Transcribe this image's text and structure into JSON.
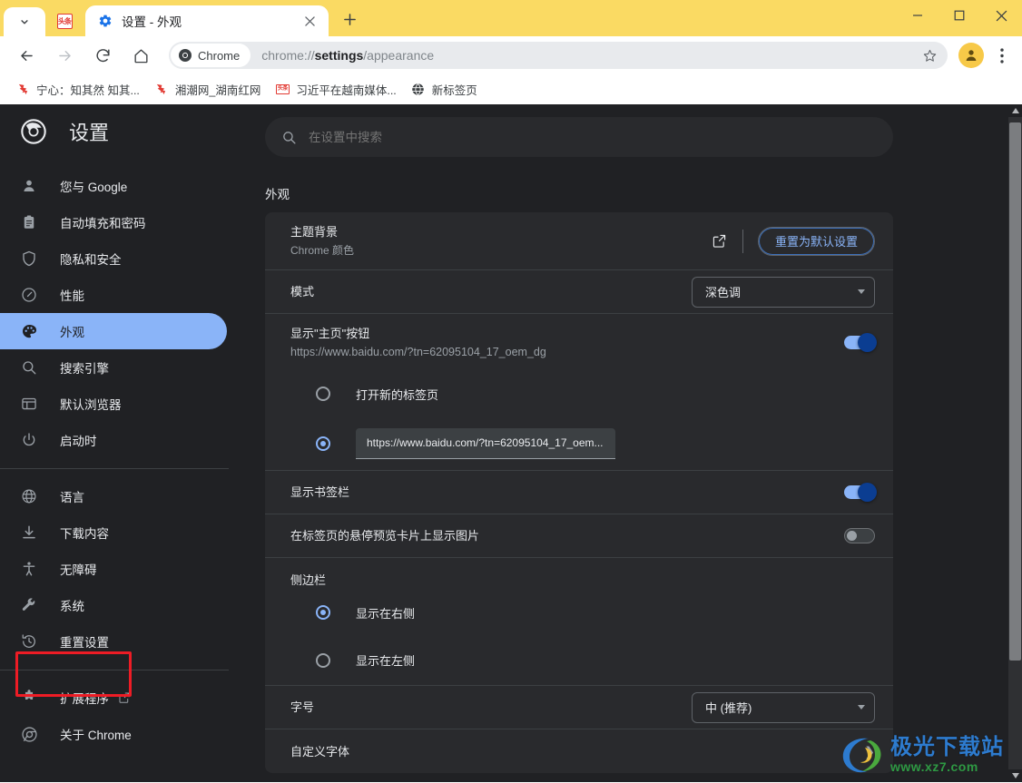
{
  "window": {
    "minimize_label": "—",
    "maximize_label": "□",
    "close_label": "✕"
  },
  "tabstrip": {
    "tab_search_name": "tab-search",
    "pinned_tab_label": "头条",
    "active_tab_title": "设置 - 外观",
    "new_tab_label": "+",
    "close_tab_label": "✕"
  },
  "toolbar": {
    "back_label": "←",
    "forward_label": "→",
    "reload_label": "⟳",
    "home_label": "⌂",
    "chrome_chip_label": "Chrome",
    "url_prefix": "chrome://",
    "url_bold": "settings",
    "url_suffix": "/appearance",
    "bookmark_star": "☆",
    "menu_label": "⋮"
  },
  "bookmarks": [
    {
      "label": "宁心：知其然 知其...",
      "icon": "xiangchao-icon"
    },
    {
      "label": "湘潮网_湖南红网",
      "icon": "xiangchao-icon"
    },
    {
      "label": "习近平在越南媒体...",
      "icon": "toutiao-icon"
    },
    {
      "label": "新标签页",
      "icon": "globe-icon"
    }
  ],
  "settings": {
    "title": "设置",
    "search": {
      "placeholder": "在设置中搜索",
      "value": ""
    },
    "sidebar": [
      {
        "label": "您与 Google",
        "icon": "person-icon",
        "selected": false
      },
      {
        "label": "自动填充和密码",
        "icon": "clipboard-icon",
        "selected": false
      },
      {
        "label": "隐私和安全",
        "icon": "shield-icon",
        "selected": false
      },
      {
        "label": "性能",
        "icon": "speedometer-icon",
        "selected": false
      },
      {
        "label": "外观",
        "icon": "palette-icon",
        "selected": true
      },
      {
        "label": "搜索引擎",
        "icon": "search-icon",
        "selected": false
      },
      {
        "label": "默认浏览器",
        "icon": "browser-icon",
        "selected": false
      },
      {
        "label": "启动时",
        "icon": "power-icon",
        "selected": false
      },
      {
        "label": "语言",
        "icon": "globe-icon",
        "selected": false
      },
      {
        "label": "下载内容",
        "icon": "download-icon",
        "selected": false
      },
      {
        "label": "无障碍",
        "icon": "accessibility-icon",
        "selected": false,
        "highlighted": true
      },
      {
        "label": "系统",
        "icon": "wrench-icon",
        "selected": false
      },
      {
        "label": "重置设置",
        "icon": "history-icon",
        "selected": false
      },
      {
        "label": "扩展程序",
        "icon": "puzzle-icon",
        "selected": false,
        "external": true
      },
      {
        "label": "关于 Chrome",
        "icon": "chrome-icon",
        "selected": false
      }
    ],
    "section_heading": "外观",
    "rows": {
      "theme": {
        "title": "主题背景",
        "subtitle": "Chrome 颜色",
        "open_icon": "external-link-icon",
        "reset_button": "重置为默认设置"
      },
      "mode": {
        "title": "模式",
        "value": "深色调"
      },
      "home_button": {
        "title": "显示\"主页\"按钮",
        "subtitle": "https://www.baidu.com/?tn=62095104_17_oem_dg",
        "toggle_state": "on",
        "option_newtab": "打开新的标签页",
        "option_custom_value": "https://www.baidu.com/?tn=62095104_17_oem...",
        "option_custom_selected": true
      },
      "bookmarks_bar": {
        "title": "显示书签栏",
        "toggle_state": "on"
      },
      "hover_card_images": {
        "title": "在标签页的悬停预览卡片上显示图片",
        "toggle_state": "off"
      },
      "sidepanel": {
        "title": "侧边栏",
        "option_right": "显示在右侧",
        "option_left": "显示在左侧",
        "selected": "right"
      },
      "font_size": {
        "title": "字号",
        "value": "中 (推荐)"
      },
      "customize_fonts": {
        "title": "自定义字体",
        "chevron": "❯"
      }
    }
  },
  "watermark": {
    "main": "极光下载站",
    "sub": "www.xz7.com"
  },
  "colors": {
    "titlebar": "#fada63",
    "accent_blue": "#8ab4f8",
    "page_bg": "#202124",
    "card_bg": "#292a2d",
    "highlight_red": "#ee1c25"
  }
}
